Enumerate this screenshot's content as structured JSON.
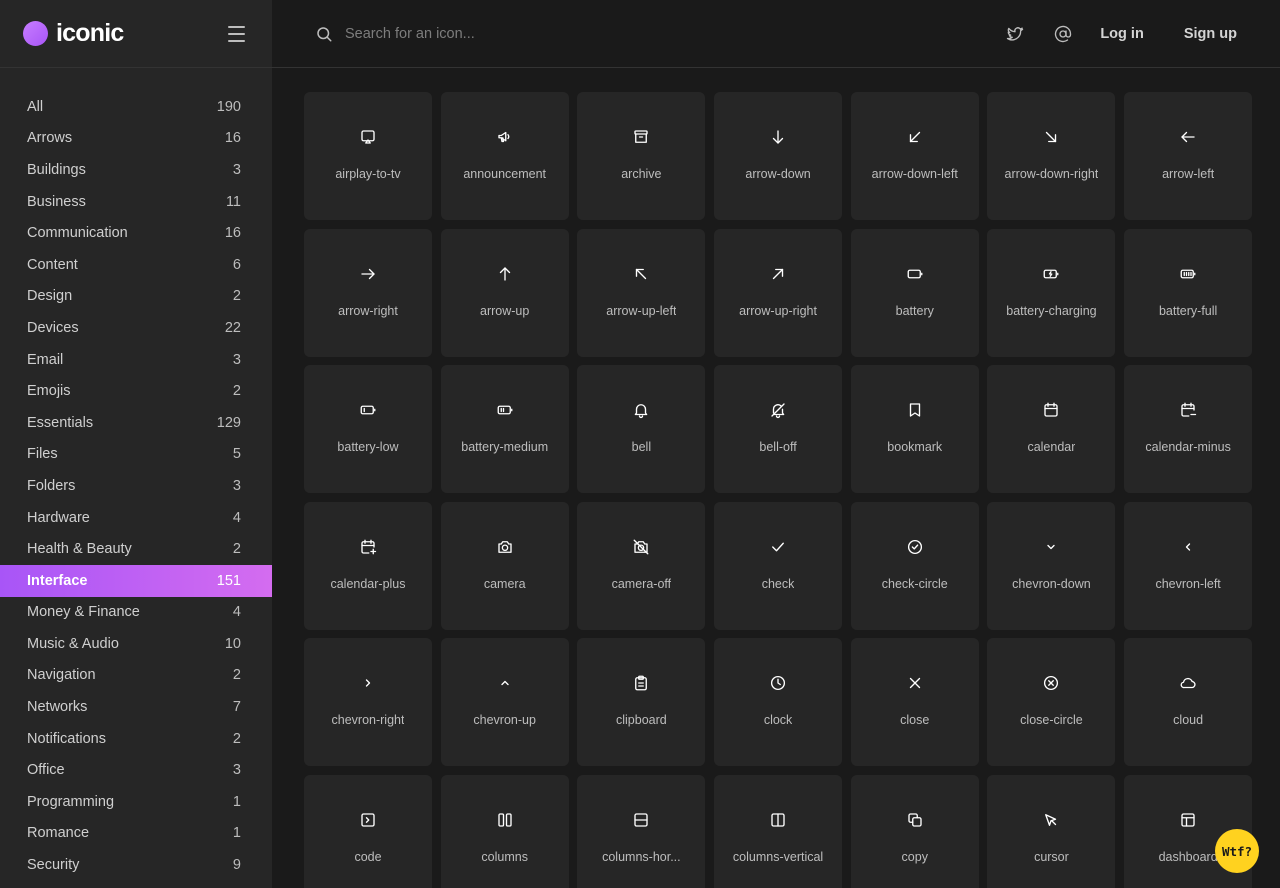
{
  "brand": {
    "name": "iconic"
  },
  "search": {
    "placeholder": "Search for an icon..."
  },
  "topbar": {
    "login_label": "Log in",
    "signup_label": "Sign up"
  },
  "colors": {
    "accent_start": "#a855f7",
    "accent_end": "#d46cf0",
    "background": "#1a1a1a",
    "surface": "#262626",
    "badge": "#ffd21f"
  },
  "categories": [
    {
      "label": "All",
      "count": "190"
    },
    {
      "label": "Arrows",
      "count": "16"
    },
    {
      "label": "Buildings",
      "count": "3"
    },
    {
      "label": "Business",
      "count": "11"
    },
    {
      "label": "Communication",
      "count": "16"
    },
    {
      "label": "Content",
      "count": "6"
    },
    {
      "label": "Design",
      "count": "2"
    },
    {
      "label": "Devices",
      "count": "22"
    },
    {
      "label": "Email",
      "count": "3"
    },
    {
      "label": "Emojis",
      "count": "2"
    },
    {
      "label": "Essentials",
      "count": "129"
    },
    {
      "label": "Files",
      "count": "5"
    },
    {
      "label": "Folders",
      "count": "3"
    },
    {
      "label": "Hardware",
      "count": "4"
    },
    {
      "label": "Health & Beauty",
      "count": "2"
    },
    {
      "label": "Interface",
      "count": "151",
      "active": true
    },
    {
      "label": "Money & Finance",
      "count": "4"
    },
    {
      "label": "Music & Audio",
      "count": "10"
    },
    {
      "label": "Navigation",
      "count": "2"
    },
    {
      "label": "Networks",
      "count": "7"
    },
    {
      "label": "Notifications",
      "count": "2"
    },
    {
      "label": "Office",
      "count": "3"
    },
    {
      "label": "Programming",
      "count": "1"
    },
    {
      "label": "Romance",
      "count": "1"
    },
    {
      "label": "Security",
      "count": "9"
    }
  ],
  "icons": [
    {
      "label": "airplay-to-tv",
      "icon": "airplay-to-tv"
    },
    {
      "label": "announcement",
      "icon": "announcement"
    },
    {
      "label": "archive",
      "icon": "archive"
    },
    {
      "label": "arrow-down",
      "icon": "arrow-down"
    },
    {
      "label": "arrow-down-left",
      "icon": "arrow-down-left"
    },
    {
      "label": "arrow-down-right",
      "icon": "arrow-down-right"
    },
    {
      "label": "arrow-left",
      "icon": "arrow-left"
    },
    {
      "label": "arrow-right",
      "icon": "arrow-right"
    },
    {
      "label": "arrow-up",
      "icon": "arrow-up"
    },
    {
      "label": "arrow-up-left",
      "icon": "arrow-up-left"
    },
    {
      "label": "arrow-up-right",
      "icon": "arrow-up-right"
    },
    {
      "label": "battery",
      "icon": "battery"
    },
    {
      "label": "battery-charging",
      "icon": "battery-charging"
    },
    {
      "label": "battery-full",
      "icon": "battery-full"
    },
    {
      "label": "battery-low",
      "icon": "battery-low"
    },
    {
      "label": "battery-medium",
      "icon": "battery-medium"
    },
    {
      "label": "bell",
      "icon": "bell"
    },
    {
      "label": "bell-off",
      "icon": "bell-off"
    },
    {
      "label": "bookmark",
      "icon": "bookmark"
    },
    {
      "label": "calendar",
      "icon": "calendar"
    },
    {
      "label": "calendar-minus",
      "icon": "calendar-minus"
    },
    {
      "label": "calendar-plus",
      "icon": "calendar-plus"
    },
    {
      "label": "camera",
      "icon": "camera"
    },
    {
      "label": "camera-off",
      "icon": "camera-off"
    },
    {
      "label": "check",
      "icon": "check"
    },
    {
      "label": "check-circle",
      "icon": "check-circle"
    },
    {
      "label": "chevron-down",
      "icon": "chevron-down"
    },
    {
      "label": "chevron-left",
      "icon": "chevron-left"
    },
    {
      "label": "chevron-right",
      "icon": "chevron-right"
    },
    {
      "label": "chevron-up",
      "icon": "chevron-up"
    },
    {
      "label": "clipboard",
      "icon": "clipboard"
    },
    {
      "label": "clock",
      "icon": "clock"
    },
    {
      "label": "close",
      "icon": "close"
    },
    {
      "label": "close-circle",
      "icon": "close-circle"
    },
    {
      "label": "cloud",
      "icon": "cloud"
    },
    {
      "label": "code",
      "icon": "code"
    },
    {
      "label": "columns",
      "icon": "columns"
    },
    {
      "label": "columns-hor...",
      "icon": "columns-horizontal"
    },
    {
      "label": "columns-vertical",
      "icon": "columns-vertical"
    },
    {
      "label": "copy",
      "icon": "copy"
    },
    {
      "label": "cursor",
      "icon": "cursor"
    },
    {
      "label": "dashboard",
      "icon": "dashboard"
    }
  ],
  "badge": {
    "label": "Wtf?"
  }
}
